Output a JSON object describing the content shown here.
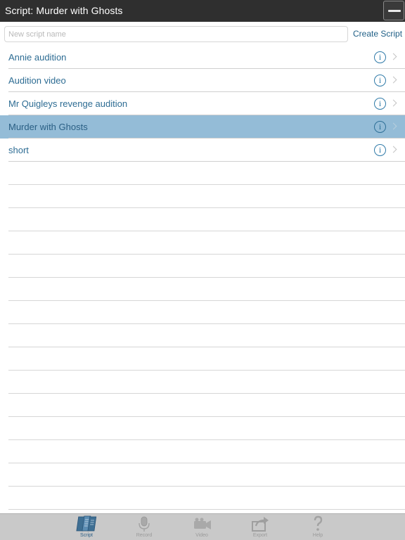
{
  "header": {
    "title": "Script:  Murder with Ghosts"
  },
  "new_script": {
    "placeholder": "New script name",
    "value": "",
    "create_label": "Create Script"
  },
  "scripts": [
    {
      "name": "Annie audition",
      "selected": false
    },
    {
      "name": "Audition video",
      "selected": false
    },
    {
      "name": "Mr Quigleys revenge audition",
      "selected": false
    },
    {
      "name": "Murder with Ghosts",
      "selected": true
    },
    {
      "name": "short",
      "selected": false
    }
  ],
  "info_glyph": "i",
  "tabs": [
    {
      "label": "Script",
      "icon": "script-icon",
      "active": true
    },
    {
      "label": "Record",
      "icon": "microphone-icon",
      "active": false
    },
    {
      "label": "Video",
      "icon": "video-camera-icon",
      "active": false
    },
    {
      "label": "Export",
      "icon": "export-icon",
      "active": false
    },
    {
      "label": "Help",
      "icon": "help-icon",
      "active": false
    }
  ],
  "colors": {
    "title_bar": "#2f2f2f",
    "accent": "#2d6c93",
    "selected_row": "#94bcd7",
    "tab_bar": "#c9c9c9"
  }
}
